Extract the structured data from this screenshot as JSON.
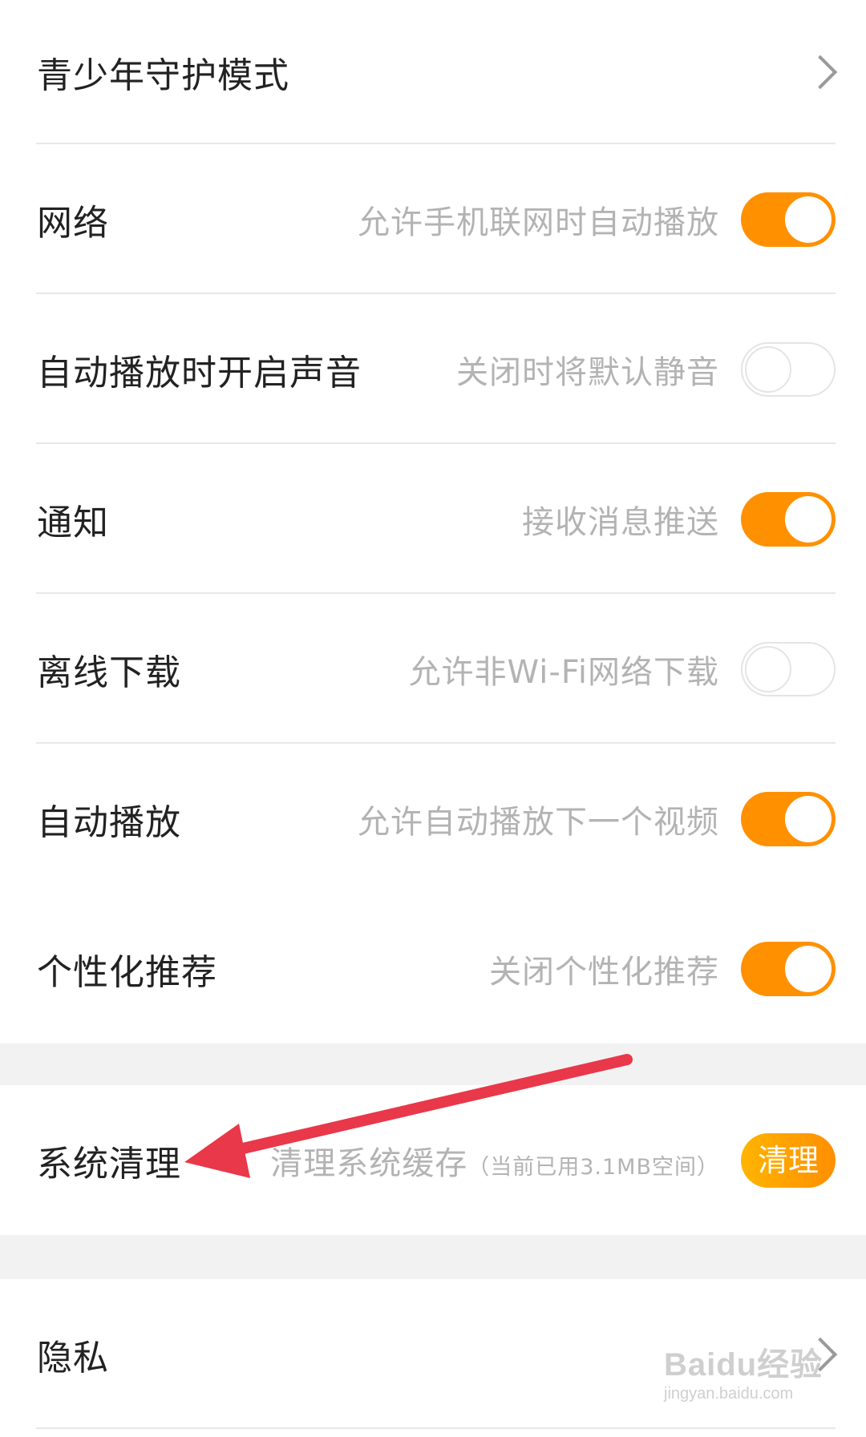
{
  "colors": {
    "accent": "#ff9000",
    "label": "#222222",
    "description": "#b3b3b3",
    "section_gap": "#f2f2f2",
    "arrow": "#e8384a"
  },
  "settings": [
    {
      "label": "青少年守护模式",
      "control": "chevron"
    },
    {
      "label": "网络",
      "description": "允许手机联网时自动播放",
      "control": "toggle",
      "on": true
    },
    {
      "label": "自动播放时开启声音",
      "description": "关闭时将默认静音",
      "control": "toggle",
      "on": false
    },
    {
      "label": "通知",
      "description": "接收消息推送",
      "control": "toggle",
      "on": true
    },
    {
      "label": "离线下载",
      "description": "允许非Wi-Fi网络下载",
      "control": "toggle",
      "on": false
    },
    {
      "label": "自动播放",
      "description": "允许自动播放下一个视频",
      "control": "toggle",
      "on": true
    },
    {
      "label": "个性化推荐",
      "description": "关闭个性化推荐",
      "control": "toggle",
      "on": true
    }
  ],
  "system_clean": {
    "label": "系统清理",
    "description": "清理系统缓存",
    "usage": "（当前已用3.1MB空间）",
    "button_label": "清理"
  },
  "privacy": {
    "label": "隐私",
    "control": "chevron"
  },
  "annotation": {
    "icon": "red-arrow-icon"
  },
  "watermark": {
    "main": "Baidu经验",
    "sub": "jingyan.baidu.com"
  }
}
